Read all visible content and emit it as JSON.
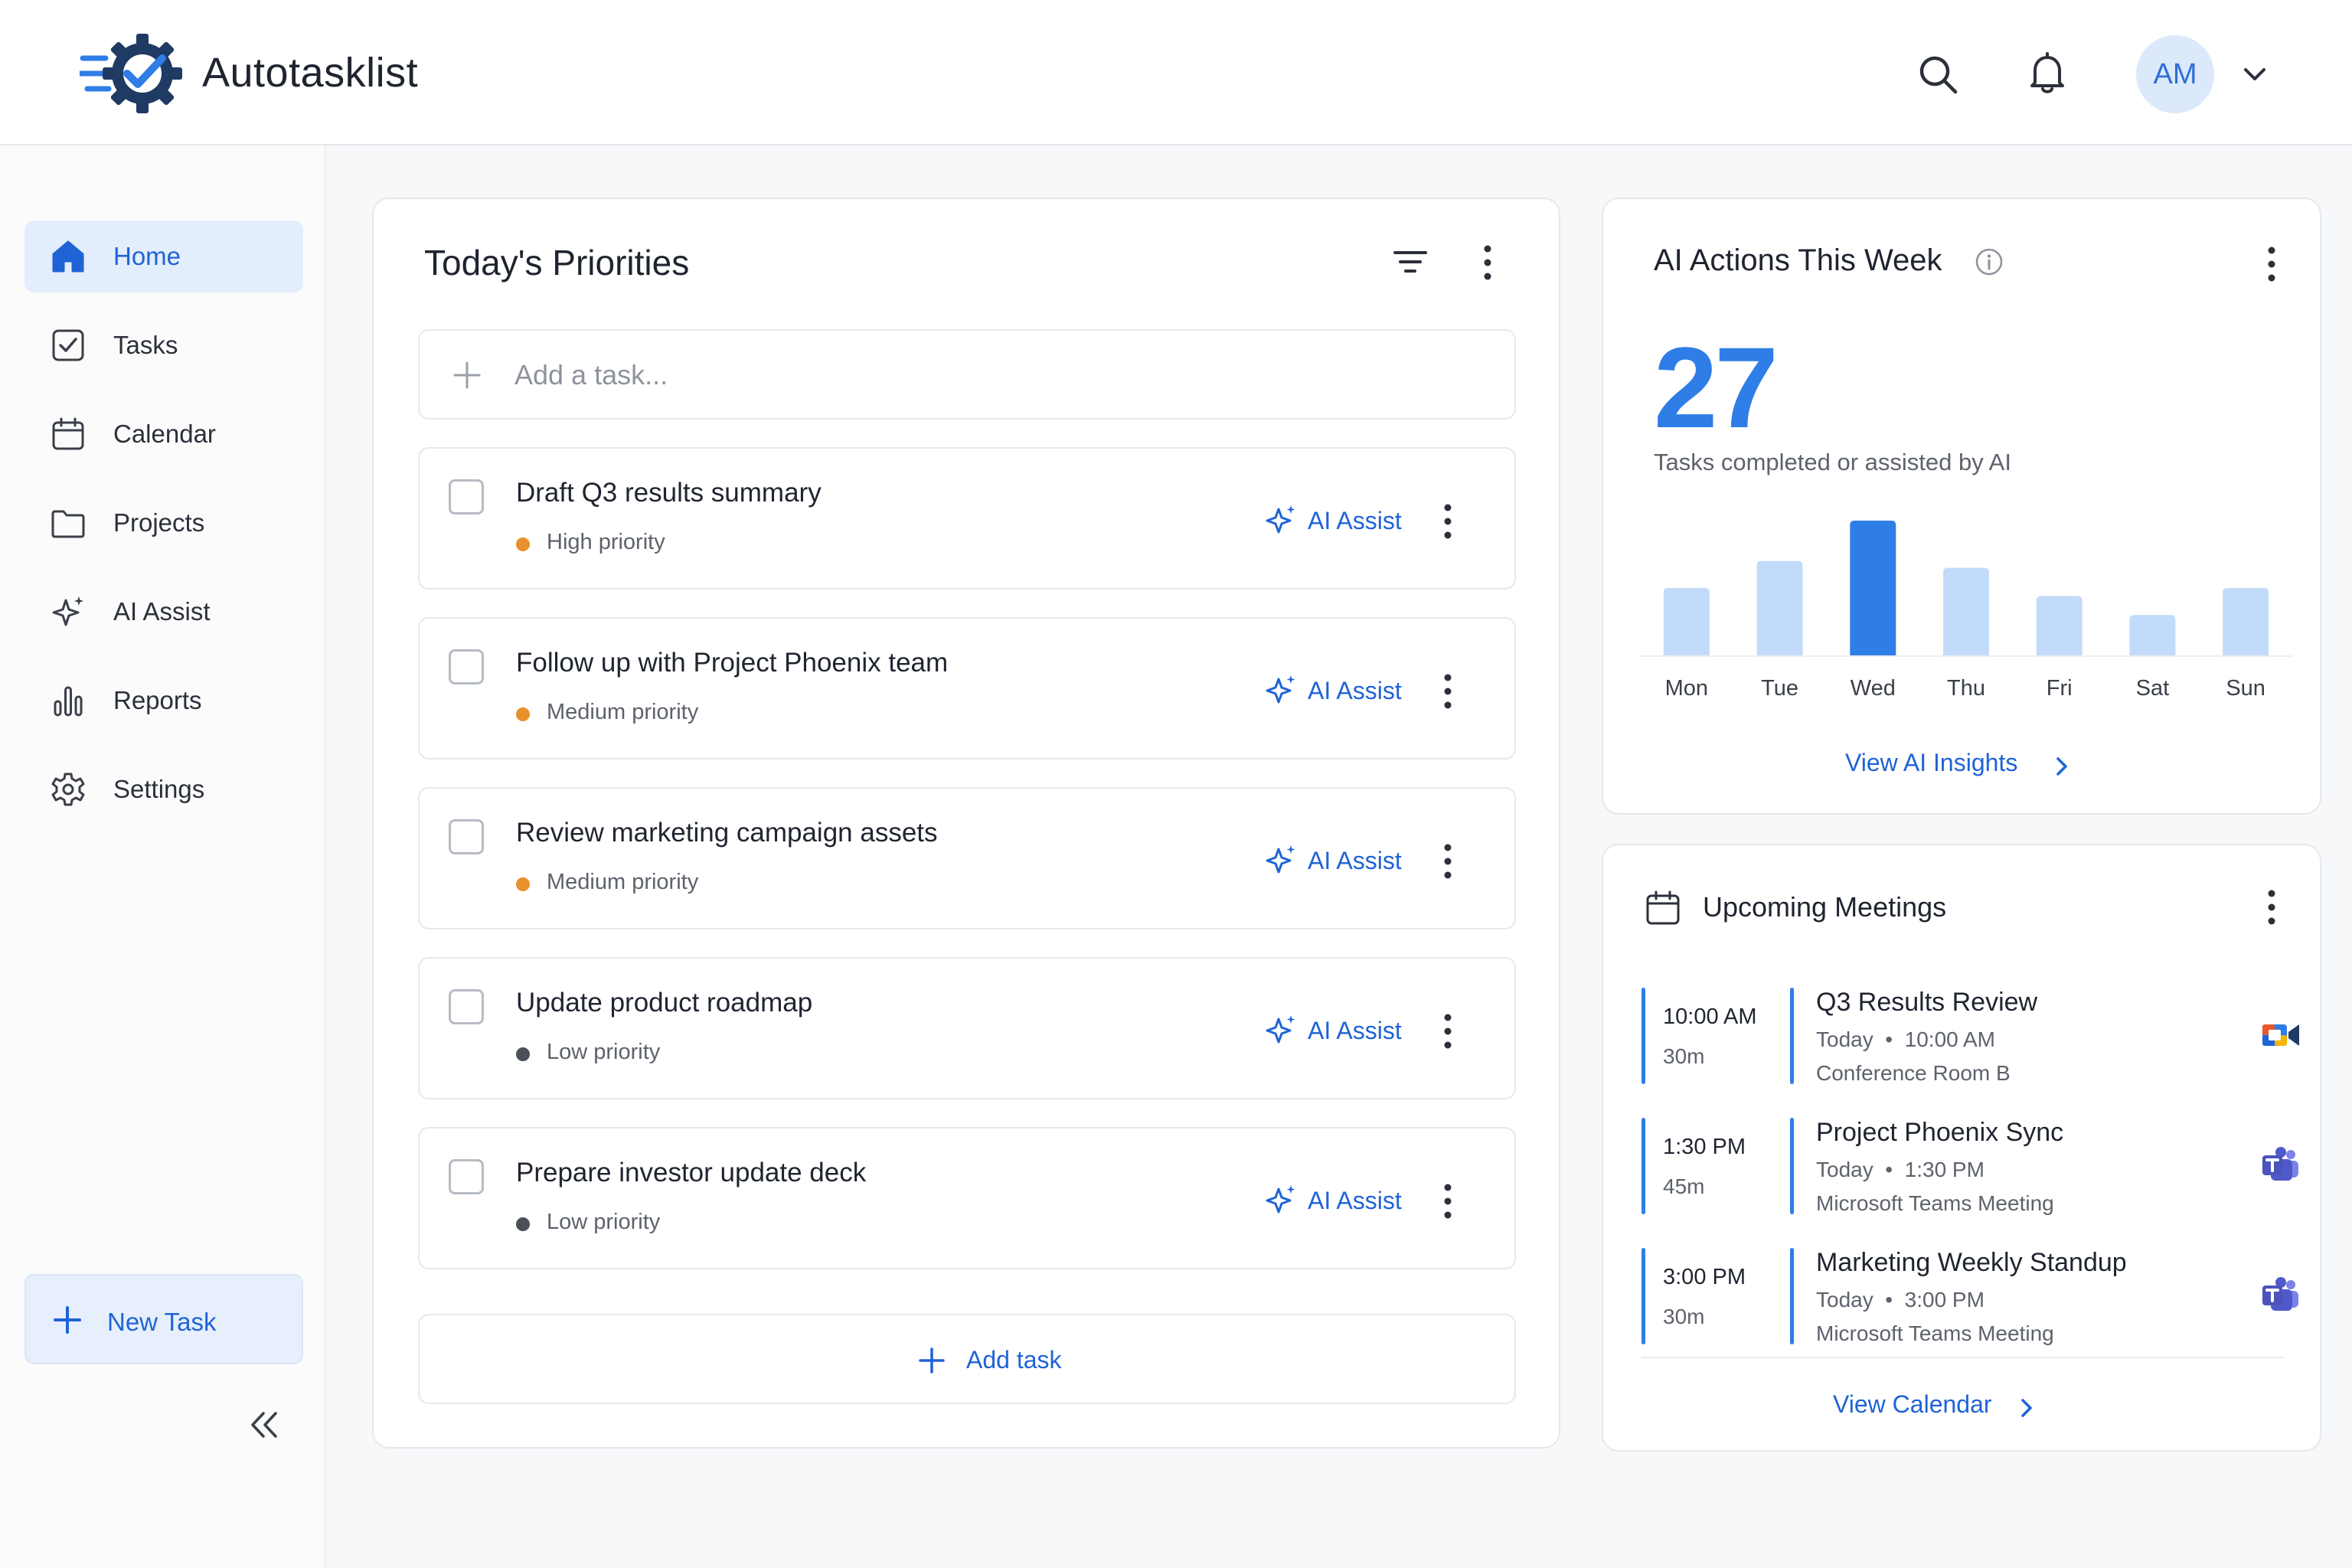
{
  "app": {
    "name": "Autotasklist"
  },
  "header": {
    "avatar_initials": "AM"
  },
  "sidebar": {
    "items": [
      {
        "label": "Home",
        "icon": "home-icon",
        "active": true
      },
      {
        "label": "Tasks",
        "icon": "tasks-icon"
      },
      {
        "label": "Calendar",
        "icon": "calendar-icon"
      },
      {
        "label": "Projects",
        "icon": "folder-icon"
      },
      {
        "label": "AI Assist",
        "icon": "sparkle-icon"
      },
      {
        "label": "Reports",
        "icon": "bar-chart-icon"
      },
      {
        "label": "Settings",
        "icon": "gear-icon"
      }
    ],
    "new_task_label": "New Task"
  },
  "priorities": {
    "title": "Today's Priorities",
    "add_placeholder": "Add a task...",
    "ai_label": "AI Assist",
    "tasks": [
      {
        "title": "Draft Q3 results summary",
        "priority": "High priority",
        "priority_color": "#e8902b"
      },
      {
        "title": "Follow up with Project Phoenix team",
        "priority": "Medium priority",
        "priority_color": "#e8902b"
      },
      {
        "title": "Review marketing campaign assets",
        "priority": "Medium priority",
        "priority_color": "#e8902b"
      },
      {
        "title": "Update product roadmap",
        "priority": "Low priority",
        "priority_color": "#4a4f58"
      },
      {
        "title": "Prepare investor update deck",
        "priority": "Low priority",
        "priority_color": "#4a4f58"
      }
    ],
    "add_task_label": "Add task"
  },
  "ai_actions": {
    "title": "AI Actions This Week",
    "count": "27",
    "subtitle": "Tasks completed or assisted by AI",
    "link_label": "View AI Insights"
  },
  "chart_data": {
    "type": "bar",
    "categories": [
      "Mon",
      "Tue",
      "Wed",
      "Thu",
      "Fri",
      "Sat",
      "Sun"
    ],
    "values": [
      5,
      7,
      10,
      6.5,
      4.4,
      3,
      5
    ],
    "highlight": "Wed",
    "colors": {
      "bar": "#c3dbfa",
      "highlight": "#2f7de6"
    },
    "grid": false
  },
  "meetings": {
    "title": "Upcoming Meetings",
    "items": [
      {
        "time": "10:00 AM",
        "duration": "30m",
        "title": "Q3 Results Review",
        "day": "Today",
        "when": "10:00 AM",
        "location": "Conference Room B",
        "app": "video-call-icon"
      },
      {
        "time": "1:30 PM",
        "duration": "45m",
        "title": "Project Phoenix Sync",
        "day": "Today",
        "when": "1:30 PM",
        "location": "Microsoft Teams Meeting",
        "app": "teams-icon"
      },
      {
        "time": "3:00 PM",
        "duration": "30m",
        "title": "Marketing Weekly Standup",
        "day": "Today",
        "when": "3:00 PM",
        "location": "Microsoft Teams Meeting",
        "app": "teams-icon"
      }
    ],
    "link_label": "View Calendar"
  }
}
